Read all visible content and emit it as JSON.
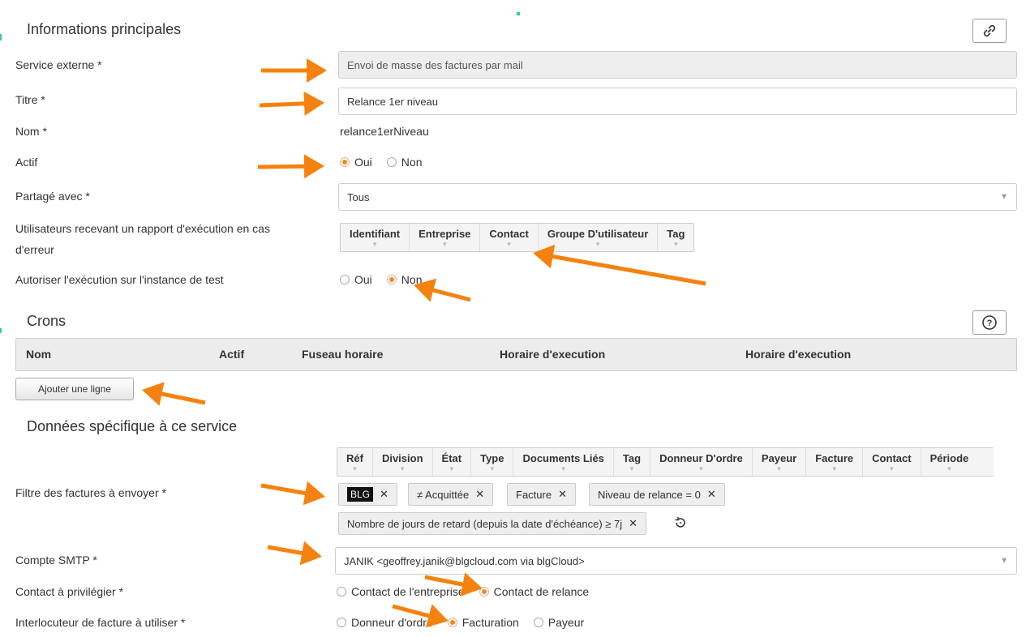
{
  "main": {
    "title": "Informations principales",
    "link_icon": "link-icon"
  },
  "fields": {
    "service_externe": {
      "label": "Service externe *",
      "value": "Envoi de masse des factures par mail"
    },
    "titre": {
      "label": "Titre *",
      "value": "Relance 1er niveau"
    },
    "nom": {
      "label": "Nom *",
      "value": "relance1erNiveau"
    },
    "actif": {
      "label": "Actif",
      "options": [
        "Oui",
        "Non"
      ],
      "selected": "Oui"
    },
    "partage": {
      "label": "Partagé avec *",
      "value": "Tous"
    },
    "utilisateurs": {
      "label_line1": "Utilisateurs recevant un rapport d'exécution en cas",
      "label_line2": "d'erreur",
      "columns": [
        "Identifiant",
        "Entreprise",
        "Contact",
        "Groupe D'utilisateur",
        "Tag"
      ]
    },
    "autoriser": {
      "label": "Autoriser l'exécution sur l'instance de test",
      "options": [
        "Oui",
        "Non"
      ],
      "selected": "Non"
    }
  },
  "crons": {
    "title": "Crons",
    "help_icon": "help-icon",
    "columns": [
      "Nom",
      "Actif",
      "Fuseau horaire",
      "Horaire d'execution",
      "Horaire d'execution"
    ],
    "add_button": "Ajouter une ligne"
  },
  "service_data": {
    "title": "Données spécifique à ce service",
    "filtre": {
      "label": "Filtre des factures à envoyer *",
      "columns": [
        "Réf",
        "Division",
        "État",
        "Type",
        "Documents Liés",
        "Tag",
        "Donneur D'ordre",
        "Payeur",
        "Facture",
        "Contact",
        "Période"
      ],
      "tags": [
        "BLG",
        "≠ Acquittée",
        "Facture",
        "Niveau de relance = 0",
        "Nombre de jours de retard (depuis la date d'échéance) ≥ 7j"
      ],
      "reset_icon": "reset-icon"
    },
    "smtp": {
      "label": "Compte SMTP *",
      "value": "JANIK <geoffrey.janik@blgcloud.com via blgCloud>"
    },
    "contact": {
      "label": "Contact à privilégier *",
      "options": [
        "Contact de l'entreprise",
        "Contact de relance"
      ],
      "selected": "Contact de relance"
    },
    "interlocuteur": {
      "label": "Interlocuteur de facture à utiliser *",
      "options": [
        "Donneur d'ordre",
        "Facturation",
        "Payeur"
      ],
      "selected": "Facturation"
    }
  },
  "colors": {
    "accent": "#f08a24",
    "arrow": "#f5820f"
  }
}
